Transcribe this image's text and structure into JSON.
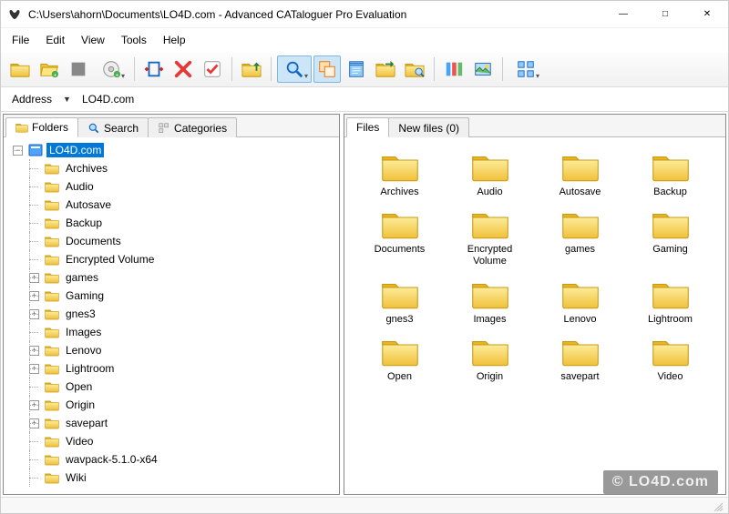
{
  "window": {
    "title": "C:\\Users\\ahorn\\Documents\\LO4D.com - Advanced CATaloguer Pro Evaluation"
  },
  "menu": {
    "file": "File",
    "edit": "Edit",
    "view": "View",
    "tools": "Tools",
    "help": "Help"
  },
  "address": {
    "label": "Address",
    "value": "LO4D.com"
  },
  "left_tabs": {
    "folders": "Folders",
    "search": "Search",
    "categories": "Categories"
  },
  "right_tabs": {
    "files": "Files",
    "newfiles": "New files (0)"
  },
  "tree": {
    "root": "LO4D.com",
    "items": [
      {
        "label": "Archives",
        "expandable": false
      },
      {
        "label": "Audio",
        "expandable": false
      },
      {
        "label": "Autosave",
        "expandable": false
      },
      {
        "label": "Backup",
        "expandable": false
      },
      {
        "label": "Documents",
        "expandable": false
      },
      {
        "label": "Encrypted Volume",
        "expandable": false
      },
      {
        "label": "games",
        "expandable": true
      },
      {
        "label": "Gaming",
        "expandable": true
      },
      {
        "label": "gnes3",
        "expandable": true
      },
      {
        "label": "Images",
        "expandable": false
      },
      {
        "label": "Lenovo",
        "expandable": true
      },
      {
        "label": "Lightroom",
        "expandable": true
      },
      {
        "label": "Open",
        "expandable": false
      },
      {
        "label": "Origin",
        "expandable": true
      },
      {
        "label": "savepart",
        "expandable": true
      },
      {
        "label": "Video",
        "expandable": false
      },
      {
        "label": "wavpack-5.1.0-x64",
        "expandable": false
      },
      {
        "label": "Wiki",
        "expandable": false
      }
    ]
  },
  "files": {
    "items": [
      "Archives",
      "Audio",
      "Autosave",
      "Backup",
      "Documents",
      "Encrypted Volume",
      "games",
      "Gaming",
      "gnes3",
      "Images",
      "Lenovo",
      "Lightroom",
      "Open",
      "Origin",
      "savepart",
      "Video"
    ]
  },
  "watermark": "© LO4D.com"
}
